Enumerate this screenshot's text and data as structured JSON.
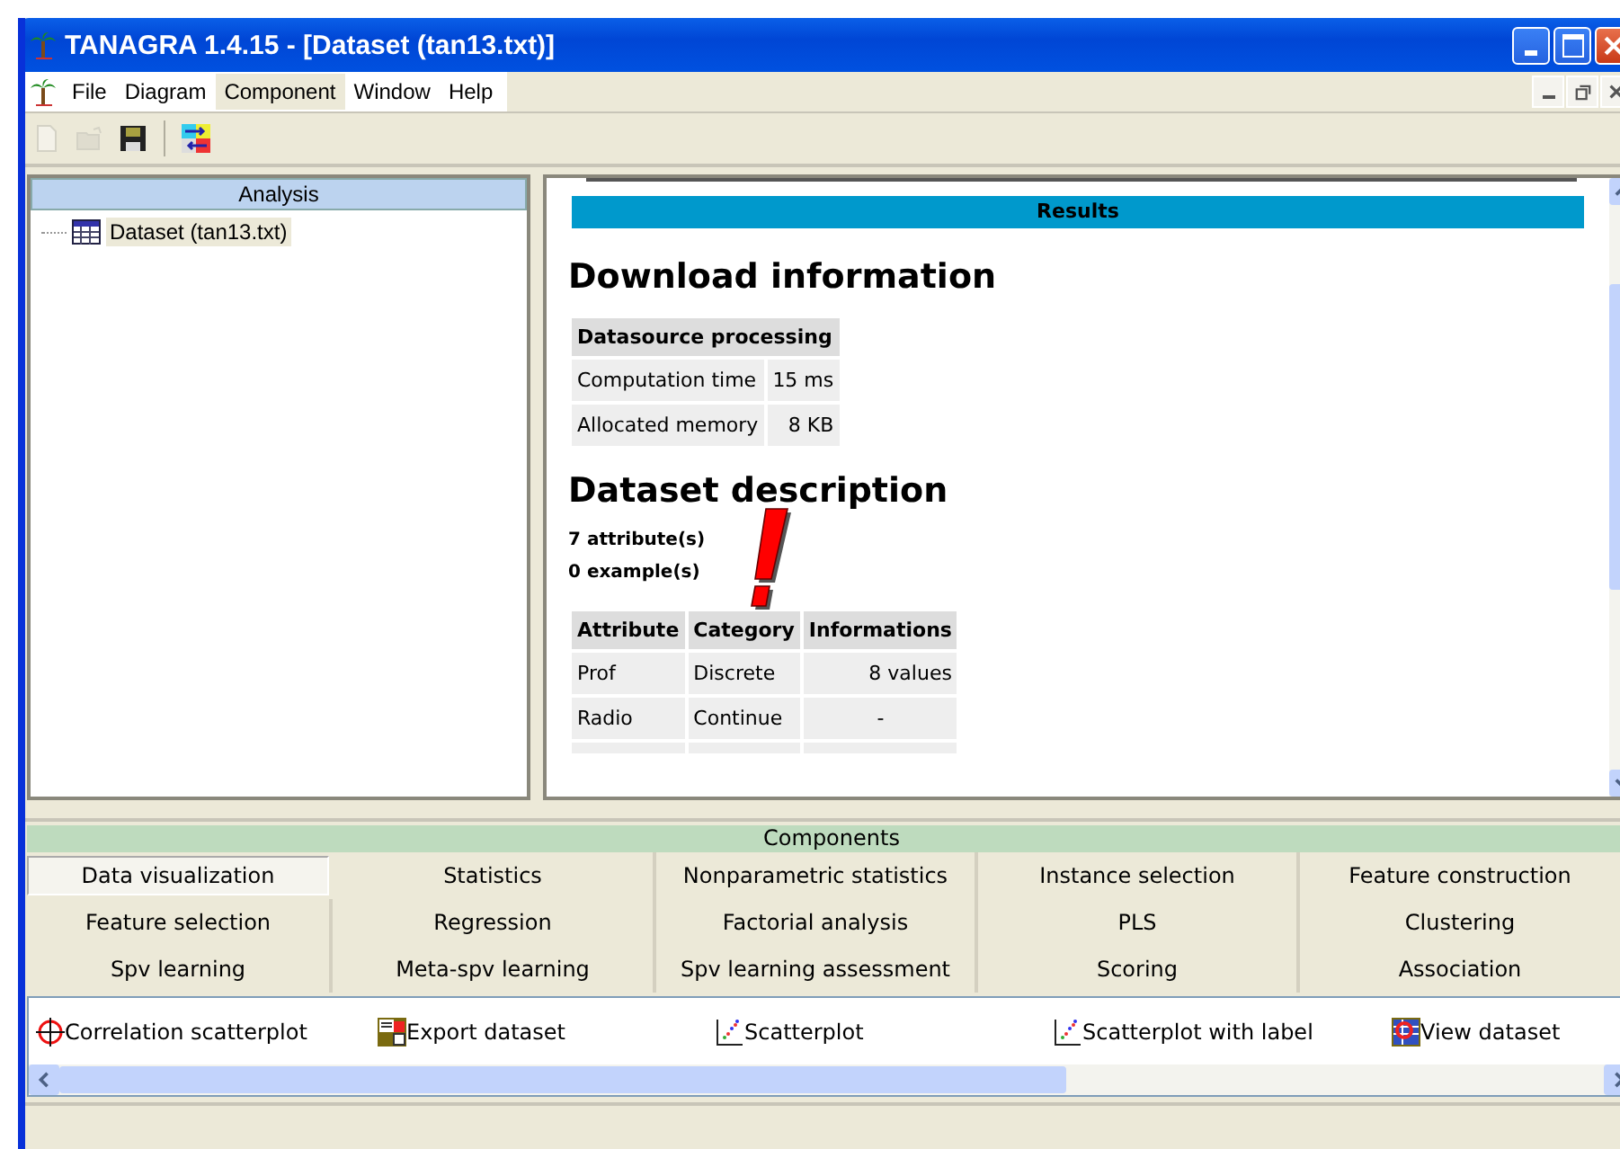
{
  "window": {
    "title": "TANAGRA 1.4.15 - [Dataset (tan13.txt)]"
  },
  "menu": [
    {
      "label": "File",
      "selected": false
    },
    {
      "label": "Diagram",
      "selected": false
    },
    {
      "label": "Component",
      "selected": true
    },
    {
      "label": "Window",
      "selected": false
    },
    {
      "label": "Help",
      "selected": false
    }
  ],
  "toolbar": [
    {
      "kind": "new",
      "disabled": true
    },
    {
      "kind": "open",
      "disabled": true
    },
    {
      "kind": "save",
      "disabled": false
    },
    {
      "kind": "execute",
      "disabled": false
    }
  ],
  "analysis": {
    "title": "Analysis",
    "tree": [
      {
        "label": "Dataset (tan13.txt)"
      }
    ]
  },
  "results": {
    "banner": "Results",
    "download": {
      "heading": "Download information",
      "table_title": "Datasource processing",
      "rows": [
        [
          "Computation time",
          "15 ms"
        ],
        [
          "Allocated memory",
          "8 KB"
        ]
      ]
    },
    "dataset": {
      "heading": "Dataset description",
      "counts": [
        "7 attribute(s)",
        "0 example(s)"
      ],
      "columns": [
        "Attribute",
        "Category",
        "Informations"
      ],
      "rows": [
        [
          "Prof",
          "Discrete",
          "8 values"
        ],
        [
          "Radio",
          "Continue",
          "-"
        ]
      ]
    }
  },
  "components": {
    "title": "Components",
    "tabs": [
      {
        "label": "Data visualization",
        "selected": true
      },
      {
        "label": "Statistics",
        "selected": false
      },
      {
        "label": "Nonparametric statistics",
        "selected": false
      },
      {
        "label": "Instance selection",
        "selected": false
      },
      {
        "label": "Feature construction",
        "selected": false
      },
      {
        "label": "Feature selection",
        "selected": false
      },
      {
        "label": "Regression",
        "selected": false
      },
      {
        "label": "Factorial analysis",
        "selected": false
      },
      {
        "label": "PLS",
        "selected": false
      },
      {
        "label": "Clustering",
        "selected": false
      },
      {
        "label": "Spv learning",
        "selected": false
      },
      {
        "label": "Meta-spv learning",
        "selected": false
      },
      {
        "label": "Spv learning assessment",
        "selected": false
      },
      {
        "label": "Scoring",
        "selected": false
      },
      {
        "label": "Association",
        "selected": false
      }
    ],
    "items": [
      {
        "label": "Correlation scatterplot",
        "kind": "correlation"
      },
      {
        "label": "Export dataset",
        "kind": "export"
      },
      {
        "label": "Scatterplot",
        "kind": "scatter"
      },
      {
        "label": "Scatterplot with label",
        "kind": "scatter"
      },
      {
        "label": "View dataset",
        "kind": "view"
      }
    ]
  }
}
